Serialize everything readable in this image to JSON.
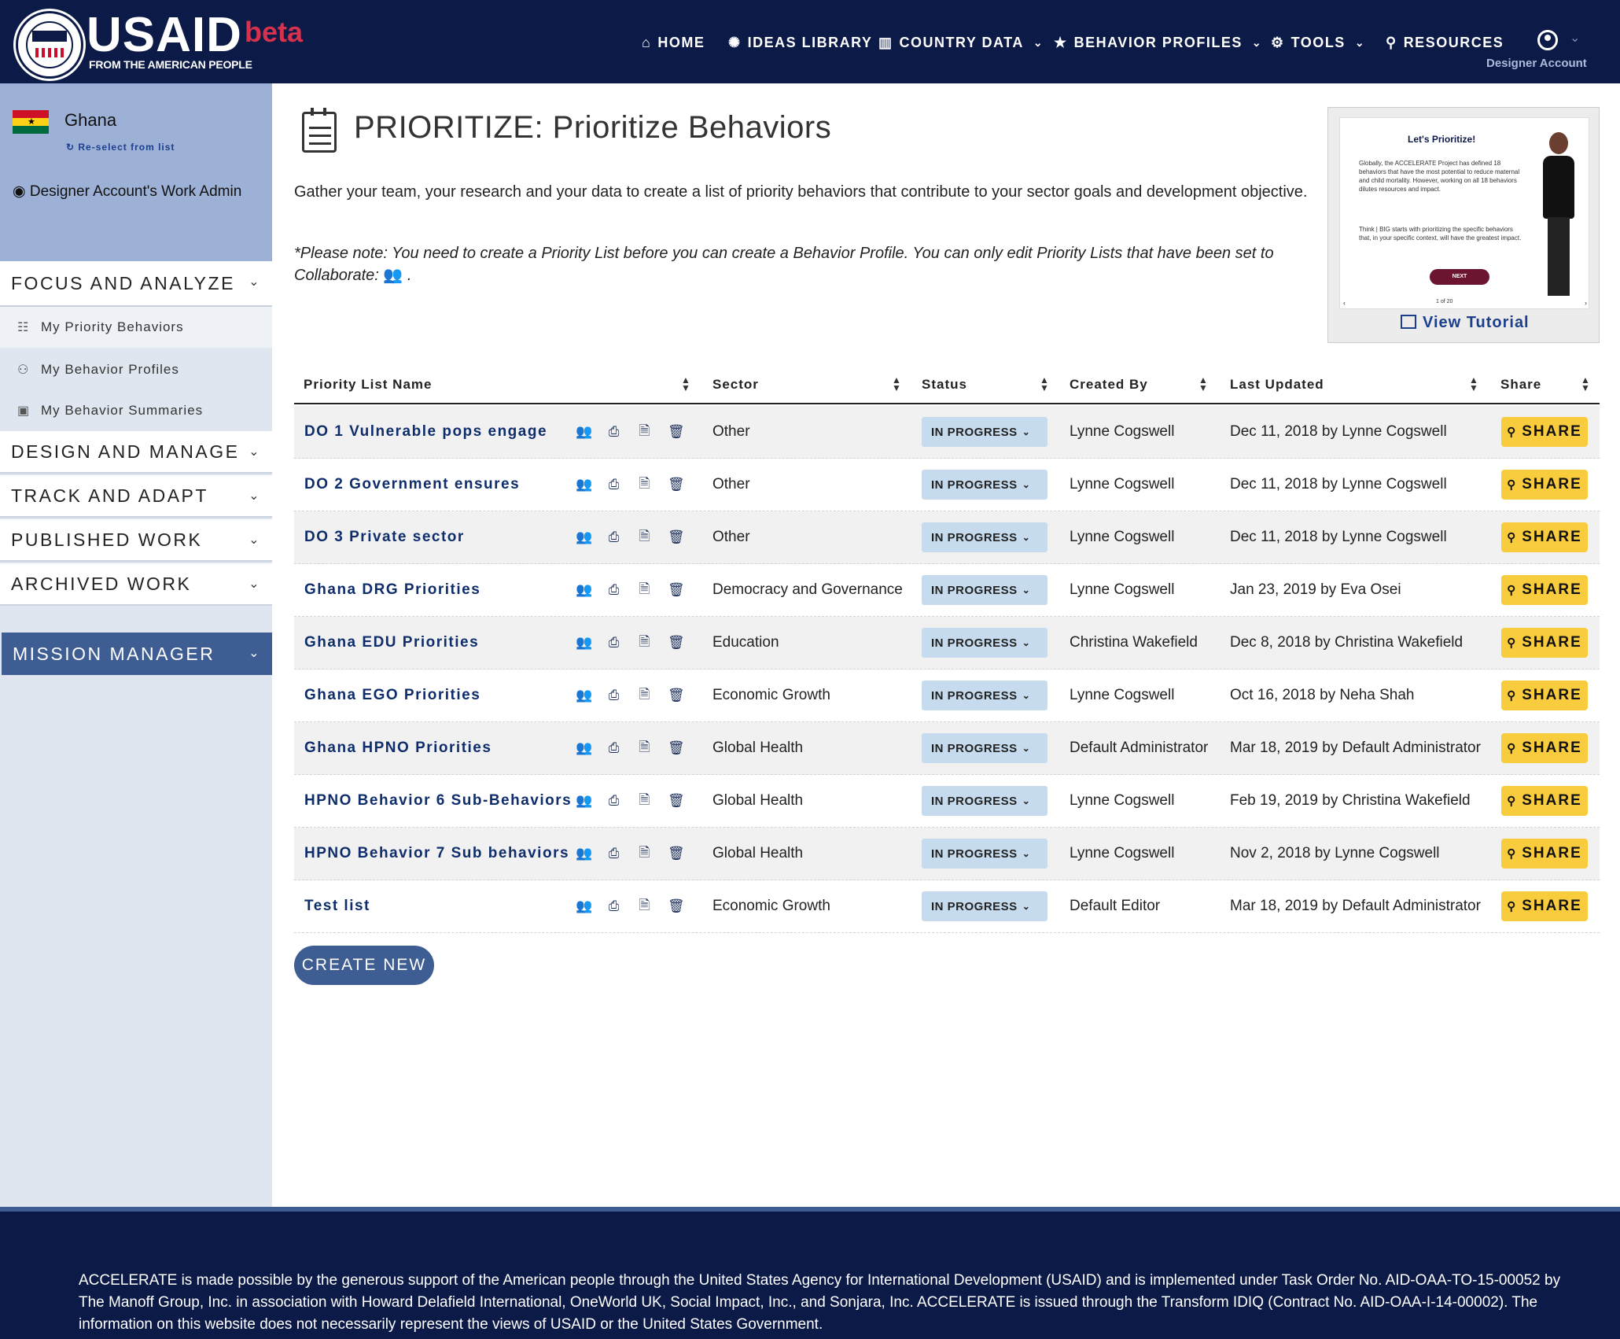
{
  "brand": {
    "name": "USAID",
    "tagline": "FROM THE AMERICAN PEOPLE",
    "badge": "beta",
    "colors": {
      "navy": "#0c1a47",
      "accent": "#3e5d93",
      "share": "#f8cc3c",
      "status": "#c6dcee",
      "beta": "#d6324d"
    }
  },
  "nav": {
    "home": "HOME",
    "ideas": "IDEAS LIBRARY",
    "country": "COUNTRY DATA",
    "profiles": "BEHAVIOR PROFILES",
    "tools": "TOOLS",
    "resources": "RESOURCES",
    "account": "Designer Account"
  },
  "sidebar": {
    "country": "Ghana",
    "reselect": "Re-select from list",
    "work": "Designer Account's Work Admin",
    "sections": {
      "focus": "FOCUS AND ANALYZE",
      "design": "DESIGN AND MANAGE",
      "track": "TRACK AND ADAPT",
      "published": "PUBLISHED WORK",
      "archived": "ARCHIVED WORK",
      "mission": "MISSION MANAGER"
    },
    "items": [
      "My Priority Behaviors",
      "My Behavior Profiles",
      "My Behavior Summaries"
    ]
  },
  "main": {
    "title": "PRIORITIZE: Prioritize Behaviors",
    "intro": "Gather your team, your research and your data to create a list of priority behaviors that contribute to your sector goals and development objective.",
    "note": "*Please note: You need to create a Priority List before you can create a Behavior Profile. You can only edit Priority Lists that have been set to Collaborate:",
    "note_end": ".",
    "tutorial": {
      "heading": "Let's Prioritize!",
      "body": "Globally, the ACCELERATE Project has defined 18 behaviors that have the most potential to reduce maternal and child mortality. However, working on all 18 behaviors dilutes resources and impact.",
      "body2": "Think | BIG starts with prioritizing the specific behaviors that, in your specific context, will have the greatest impact.",
      "button": "NEXT",
      "pager": "1 of 20",
      "link": "View Tutorial"
    },
    "create_label": "CREATE NEW"
  },
  "table": {
    "headers": {
      "name": "Priority List Name",
      "sector": "Sector",
      "status": "Status",
      "created": "Created By",
      "updated": "Last Updated",
      "share": "Share"
    },
    "status_label": "IN PROGRESS",
    "share_label": "SHARE",
    "rows": [
      {
        "name": "DO 1 Vulnerable pops engage",
        "sector": "Other",
        "created": "Lynne Cogswell",
        "updated": "Dec 11, 2018 by Lynne Cogswell"
      },
      {
        "name": "DO 2 Government ensures",
        "sector": "Other",
        "created": "Lynne Cogswell",
        "updated": "Dec 11, 2018 by Lynne Cogswell"
      },
      {
        "name": "DO 3 Private sector",
        "sector": "Other",
        "created": "Lynne Cogswell",
        "updated": "Dec 11, 2018 by Lynne Cogswell"
      },
      {
        "name": "Ghana DRG Priorities",
        "sector": "Democracy and Governance",
        "created": "Lynne Cogswell",
        "updated": "Jan 23, 2019 by Eva Osei"
      },
      {
        "name": "Ghana EDU Priorities",
        "sector": "Education",
        "created": "Christina Wakefield",
        "updated": "Dec 8, 2018 by Christina Wakefield"
      },
      {
        "name": "Ghana EGO Priorities",
        "sector": "Economic Growth",
        "created": "Lynne Cogswell",
        "updated": "Oct 16, 2018 by Neha Shah"
      },
      {
        "name": "Ghana HPNO Priorities",
        "sector": "Global Health",
        "created": "Default Administrator",
        "updated": "Mar 18, 2019 by Default Administrator"
      },
      {
        "name": "HPNO Behavior 6 Sub-Behaviors",
        "sector": "Global Health",
        "created": "Lynne Cogswell",
        "updated": "Feb 19, 2019 by Christina Wakefield"
      },
      {
        "name": "HPNO Behavior 7 Sub behaviors",
        "sector": "Global Health",
        "created": "Lynne Cogswell",
        "updated": "Nov 2, 2018 by Lynne Cogswell"
      },
      {
        "name": "Test list",
        "sector": "Economic Growth",
        "created": "Default Editor",
        "updated": "Mar 18, 2019 by Default Administrator"
      }
    ]
  },
  "footer": {
    "text": "ACCELERATE is made possible by the generous support of the American people through the United States Agency for International Development (USAID) and is implemented under Task Order No. AID-OAA-TO-15-00052 by The Manoff Group, Inc. in association with Howard Delafield International, OneWorld UK, Social Impact, Inc., and Sonjara, Inc. ACCELERATE is issued through the Transform IDIQ (Contract No. AID-OAA-I-14-00002). The information on this website does not necessarily represent the views of USAID or the United States Government."
  }
}
